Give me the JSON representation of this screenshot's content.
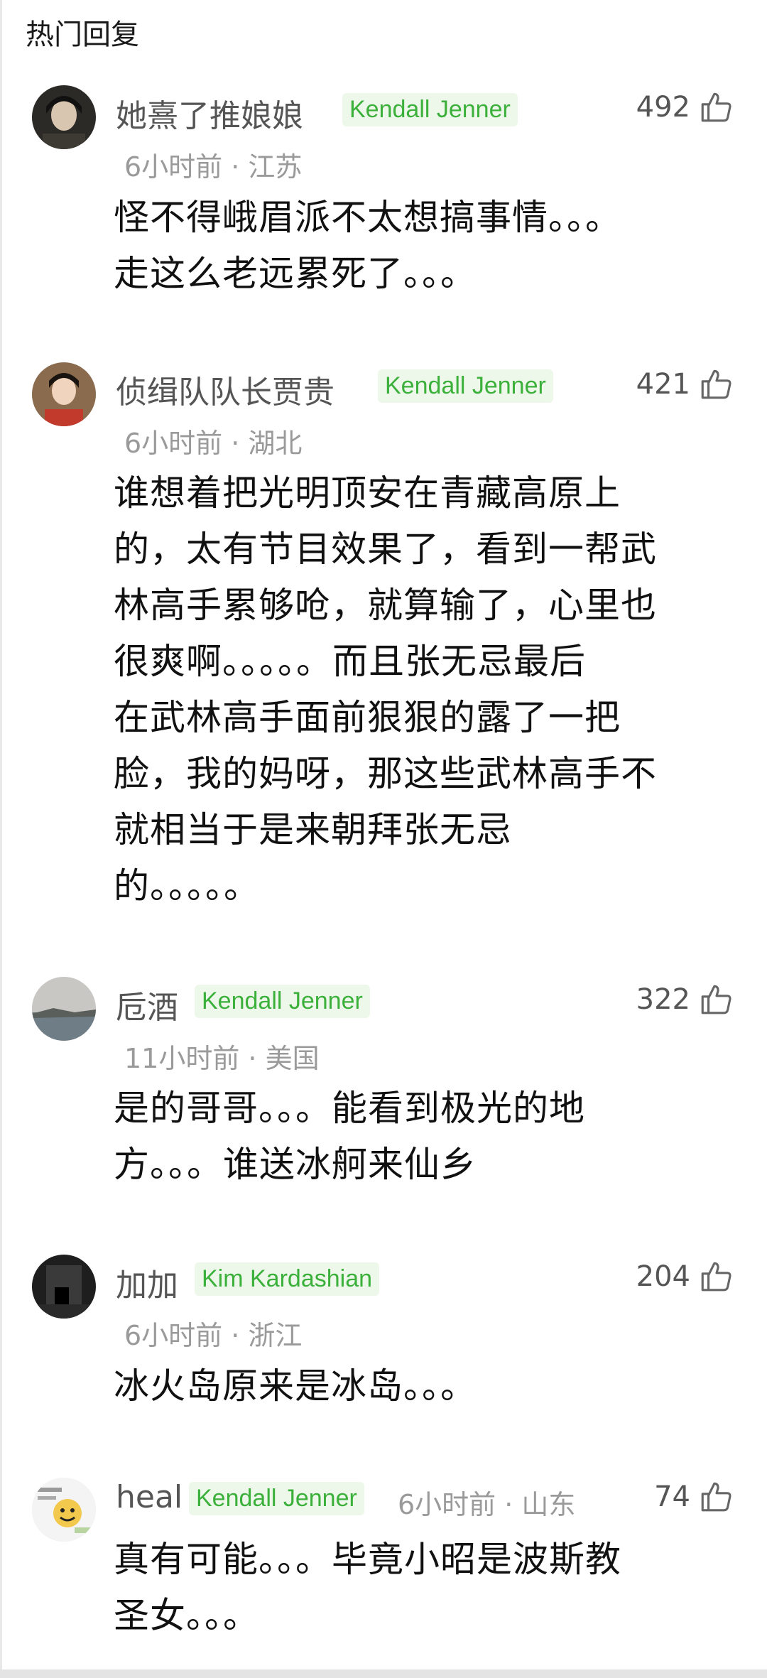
{
  "header": {
    "title": "热门回复"
  },
  "comments": [
    {
      "username": "她熹了推娘娘",
      "badge": "Kendall Jenner",
      "time_location": "6小时前 · 江苏",
      "likes": "492",
      "text": "怪不得峨眉派不太想搞事情。。。\n走这么老远累死了。。。"
    },
    {
      "username": "侦缉队队长贾贵",
      "badge": "Kendall Jenner",
      "time_location": "6小时前 · 湖北",
      "likes": "421",
      "text": "谁想着把光明顶安在青藏高原上\n的，太有节目效果了，看到一帮武\n林高手累够呛，就算输了，心里也\n很爽啊。。。。。而且张无忌最后\n在武林高手面前狠狠的露了一把\n脸，我的妈呀，那这些武林高手不\n就相当于是来朝拜张无忌\n的。。。。。"
    },
    {
      "username": "卮酒",
      "badge": "Kendall Jenner",
      "time_location": "11小时前 · 美国",
      "likes": "322",
      "text": "是的哥哥。。。能看到极光的地\n方。。。谁送冰舸来仙乡"
    },
    {
      "username": "加加",
      "badge": "Kim Kardashian",
      "time_location": "6小时前 · 浙江",
      "likes": "204",
      "text": "冰火岛原来是冰岛。。。"
    },
    {
      "username": "heal",
      "badge": "Kendall Jenner",
      "time_location": "6小时前 · 山东",
      "likes": "74",
      "text": "真有可能。。。毕竟小昭是波斯教\n圣女。。。"
    }
  ]
}
